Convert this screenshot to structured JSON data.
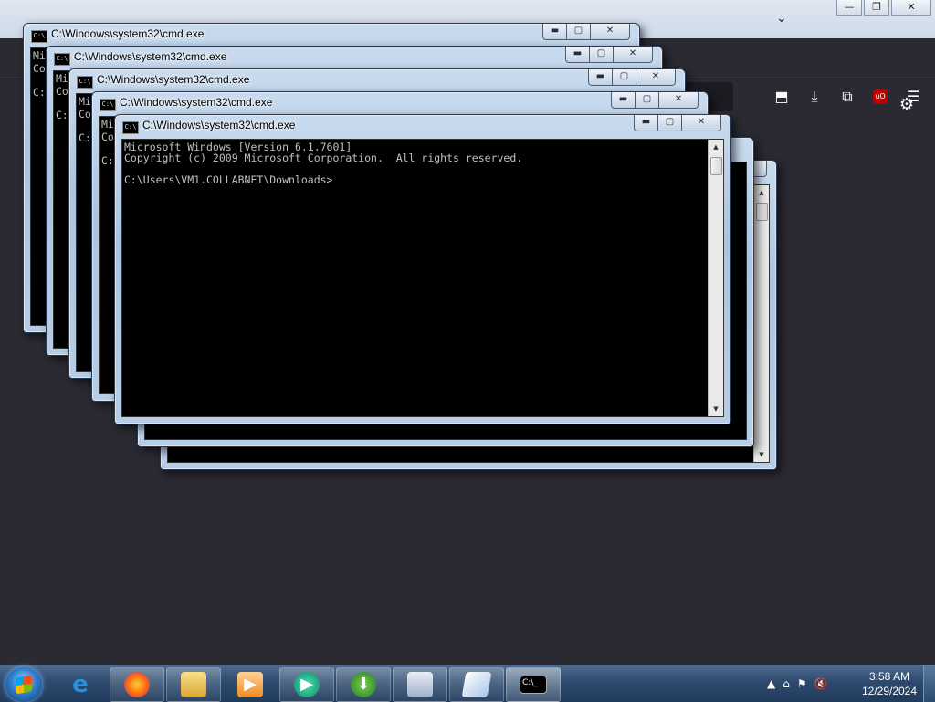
{
  "browser": {
    "tab_chevron": "⌄",
    "window_controls": {
      "minimize": "—",
      "maximize": "❐",
      "close": "✕"
    },
    "toolbar_icons": {
      "pocket": "pocket-icon",
      "download": "download-icon",
      "extensions": "extensions-icon",
      "ublock": "uO",
      "menu": "menu-icon"
    },
    "settings_icon": "gear-icon"
  },
  "cmd_windows": {
    "title": "C:\\Windows\\system32\\cmd.exe",
    "icon_text": "C:\\",
    "controls": {
      "minimize": "▬",
      "maximize": "▢",
      "close": "✕"
    },
    "background_partial_lines": [
      "Mi",
      "Co",
      "C:"
    ],
    "front_console_text": "Microsoft Windows [Version 6.1.7601]\nCopyright (c) 2009 Microsoft Corporation.  All rights reserved.\n\nC:\\Users\\VM1.COLLABNET\\Downloads>"
  },
  "taskbar": {
    "items": [
      {
        "name": "internet-explorer",
        "glyph": "e"
      },
      {
        "name": "firefox",
        "glyph": "🦊"
      },
      {
        "name": "file-explorer",
        "glyph": "📁"
      },
      {
        "name": "media-player",
        "glyph": "▶"
      },
      {
        "name": "app-5",
        "glyph": "▶"
      },
      {
        "name": "download-manager",
        "glyph": "⬇"
      },
      {
        "name": "network-app",
        "glyph": "🖥"
      },
      {
        "name": "notepad",
        "glyph": "📄"
      },
      {
        "name": "cmd",
        "glyph": "C:\\_"
      }
    ],
    "tray_icons": [
      "▲",
      "⌂",
      "⚑",
      "🔇"
    ],
    "time": "3:58 AM",
    "date": "12/29/2024"
  }
}
